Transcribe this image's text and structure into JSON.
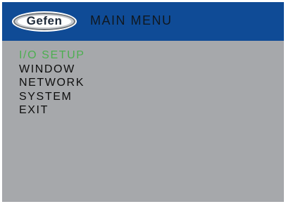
{
  "header": {
    "logo_text": "Gefen",
    "title": "MAIN MENU"
  },
  "menu": {
    "items": [
      {
        "label": "I/O SETUP",
        "selected": true
      },
      {
        "label": "WINDOW",
        "selected": false
      },
      {
        "label": "NETWORK",
        "selected": false
      },
      {
        "label": "SYSTEM",
        "selected": false
      },
      {
        "label": "EXIT",
        "selected": false
      }
    ]
  },
  "colors": {
    "header_background": "#0f4b96",
    "panel_background": "#a6a8ab",
    "selected_item": "#4caf50",
    "item_text": "#0e0e0e"
  }
}
